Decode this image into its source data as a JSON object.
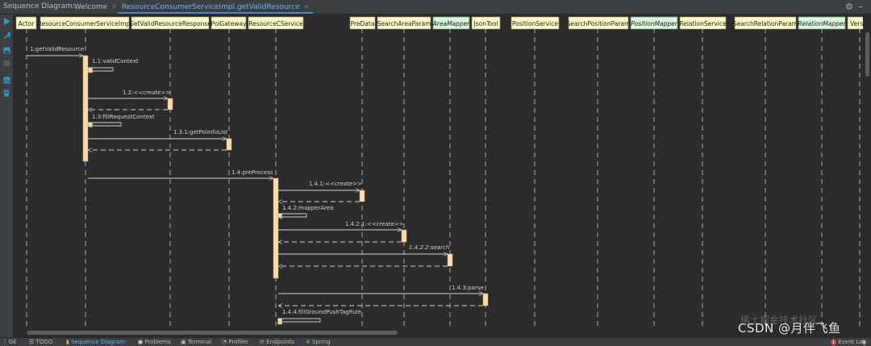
{
  "window": {
    "title": "Sequence Diagram:",
    "tabs": [
      {
        "label": "Welcome",
        "active": false
      },
      {
        "label": "ResourceConsumerServiceImpl.getValidResource",
        "active": true
      }
    ]
  },
  "participants": [
    {
      "label": "Actor",
      "italic": false,
      "color": "#fdfbc8"
    },
    {
      "label": "ResourceConsumerServiceImpl",
      "italic": false,
      "color": "#fdfbc8"
    },
    {
      "label": "GetValidResourceResponse",
      "italic": false,
      "color": "#fdfbc8"
    },
    {
      "label": "PoiGateway",
      "italic": false,
      "color": "#fdfbc8"
    },
    {
      "label": "ResourceCService",
      "italic": false,
      "color": "#fdfbc8"
    },
    {
      "label": "PreData",
      "italic": false,
      "color": "#fdfbc8"
    },
    {
      "label": "SearchAreaParam",
      "italic": false,
      "color": "#fdfbc8"
    },
    {
      "label": "AreaMapper",
      "italic": true,
      "color": "#d8f7d8"
    },
    {
      "label": "JsonTool",
      "italic": false,
      "color": "#fdfbc8"
    },
    {
      "label": "PositionService",
      "italic": false,
      "color": "#fdfbc8"
    },
    {
      "label": "SearchPositionParam",
      "italic": false,
      "color": "#fdfbc8"
    },
    {
      "label": "PositionMapper",
      "italic": true,
      "color": "#d8f7d8"
    },
    {
      "label": "RelationService",
      "italic": false,
      "color": "#fdfbc8"
    },
    {
      "label": "SearchRelationParam",
      "italic": false,
      "color": "#fdfbc8"
    },
    {
      "label": "RelationMapper",
      "italic": true,
      "color": "#d8f7d8"
    },
    {
      "label": "Versio",
      "italic": false,
      "color": "#fdfbc8"
    }
  ],
  "messages": [
    {
      "label": "1:getValidResource",
      "italic": false
    },
    {
      "label": "1.1:validContext",
      "italic": false
    },
    {
      "label": "1.2:<<create>>",
      "italic": false
    },
    {
      "label": "1.3:fillRequestContext",
      "italic": false
    },
    {
      "label": "1.3.1:getPoiInfoList",
      "italic": false
    },
    {
      "label": "1.4:preProcess",
      "italic": false
    },
    {
      "label": "1.4.1:<<create>>",
      "italic": false
    },
    {
      "label": "1.4.2:mapperArea",
      "italic": false
    },
    {
      "label": "1.4.2.1:<<create>>",
      "italic": false
    },
    {
      "label": "1.4.2.2:search",
      "italic": true
    },
    {
      "label": "1.4.3:parse",
      "italic": false
    },
    {
      "label": "1.4.4:fillGroundPushTagRule",
      "italic": false
    }
  ],
  "statusbar": {
    "items": [
      {
        "label": "Git",
        "icon": "branch-icon",
        "active": false
      },
      {
        "label": "TODO",
        "icon": "list-icon",
        "active": false
      },
      {
        "label": "Sequence Diagram",
        "icon": "sequence-icon",
        "active": true
      },
      {
        "label": "Problems",
        "icon": "problems-icon",
        "active": false
      },
      {
        "label": "Terminal",
        "icon": "terminal-icon",
        "active": false
      },
      {
        "label": "Profiler",
        "icon": "profiler-icon",
        "active": false
      },
      {
        "label": "Endpoints",
        "icon": "endpoints-icon",
        "active": false
      },
      {
        "label": "Spring",
        "icon": "spring-icon",
        "active": false
      }
    ],
    "event_log": "Event Log",
    "event_count": "1"
  },
  "watermark": "CSDN @月伴飞鱼",
  "watermark_faint": "稀土掘金技术社区",
  "colors": {
    "background": "#2b2b2b",
    "lifeline": "#d0d0d0",
    "activation": "#fcd9a6",
    "accent": "#4a88c7"
  }
}
